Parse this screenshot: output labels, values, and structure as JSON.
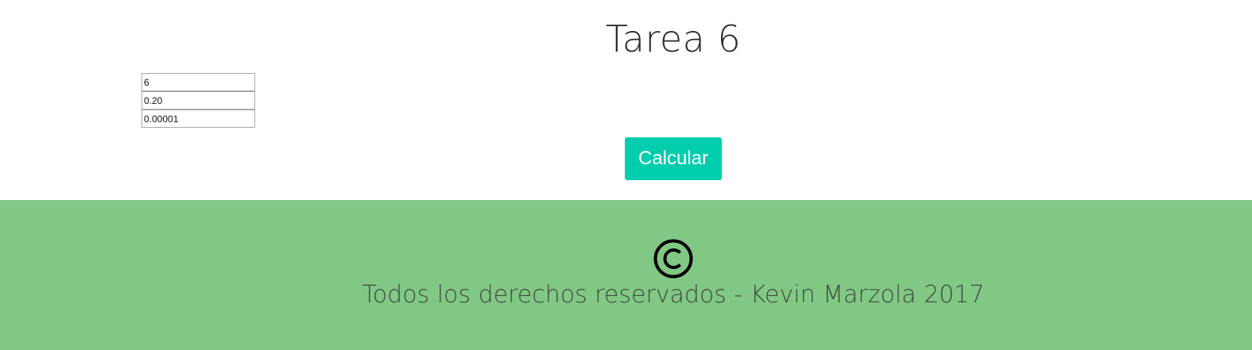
{
  "header": {
    "title": "Tarea 6"
  },
  "form": {
    "fields": [
      {
        "value": "6"
      },
      {
        "value": "0.20"
      },
      {
        "value": "0.00001"
      }
    ],
    "calculate_label": "Calcular"
  },
  "footer": {
    "icon": "copyright-icon",
    "text": "Todos los derechos reservados - Kevin Marzola 2017"
  },
  "colors": {
    "button": "#00cdae",
    "footer_background": "#81c884"
  }
}
